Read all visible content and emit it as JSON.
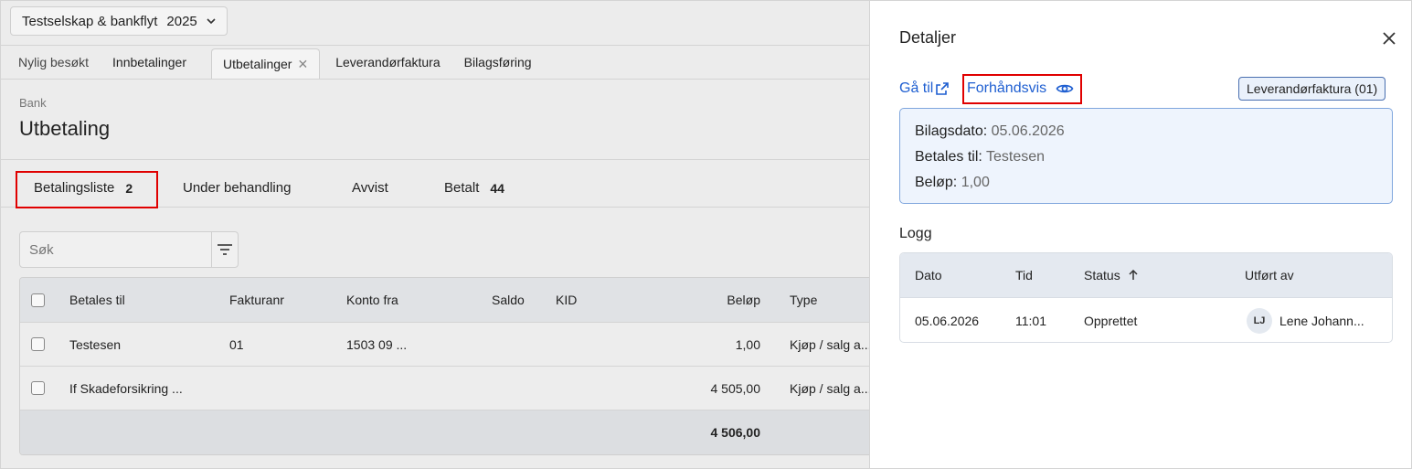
{
  "company": {
    "name": "Testselskap & bankflyt",
    "year": "2025"
  },
  "nav_tabs": [
    {
      "label": "Nylig besøkt"
    },
    {
      "label": "Innbetalinger"
    },
    {
      "label": "Utbetalinger"
    },
    {
      "label": "Leverandørfaktura"
    },
    {
      "label": "Bilagsføring"
    }
  ],
  "breadcrumb": "Bank",
  "page_title": "Utbetaling",
  "sub_tabs": [
    {
      "label": "Betalingsliste",
      "count": "2"
    },
    {
      "label": "Under behandling",
      "count": ""
    },
    {
      "label": "Avvist",
      "count": ""
    },
    {
      "label": "Betalt",
      "count": "44"
    }
  ],
  "search": {
    "placeholder": "Søk"
  },
  "table": {
    "columns": [
      "Betales til",
      "Fakturanr",
      "Konto fra",
      "Saldo",
      "KID",
      "Beløp",
      "Type"
    ],
    "rows": [
      {
        "betales_til": "Testesen",
        "fakturanr": "01",
        "konto_fra": "1503 09 ...",
        "saldo": "",
        "kid": "",
        "belop": "1,00",
        "type": "Kjøp / salg a..."
      },
      {
        "betales_til": "If Skadeforsikring ...",
        "fakturanr": "",
        "konto_fra": "",
        "saldo": "",
        "kid": "",
        "belop": "4 505,00",
        "type": "Kjøp / salg a..."
      }
    ],
    "total": "4 506,00"
  },
  "details": {
    "title": "Detaljer",
    "goto_label": "Gå til",
    "preview_label": "Forhåndsvis",
    "doc_badge": "Leverandørfaktura (01)",
    "info": [
      {
        "label": "Bilagsdato:",
        "value": "05.06.2026"
      },
      {
        "label": "Betales til:",
        "value": "Testesen"
      },
      {
        "label": "Beløp:",
        "value": "1,00"
      }
    ],
    "log_title": "Logg",
    "log_columns": [
      "Dato",
      "Tid",
      "Status",
      "Utført av"
    ],
    "log_rows": [
      {
        "dato": "05.06.2026",
        "tid": "11:01",
        "status": "Opprettet",
        "initials": "LJ",
        "user": "Lene Johann..."
      }
    ]
  },
  "colors": {
    "link": "#1f5fd1",
    "highlight_box": "#e00000",
    "info_bg": "#eef4fd"
  }
}
